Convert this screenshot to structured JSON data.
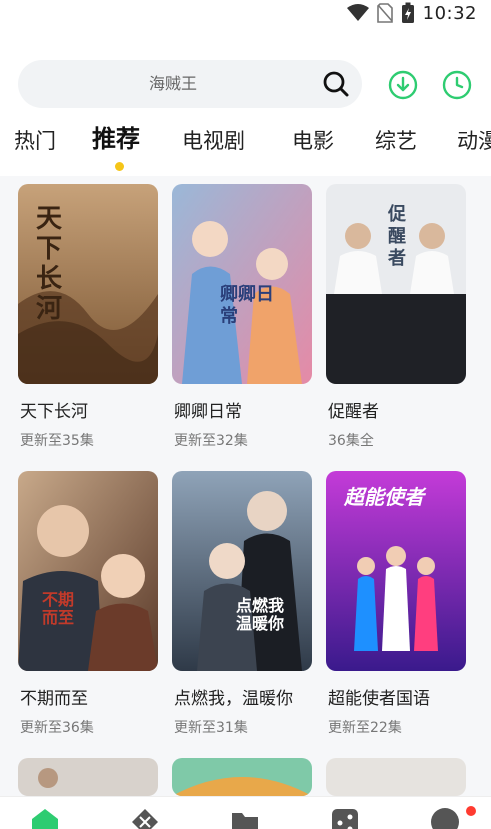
{
  "status_bar": {
    "time": "10:32"
  },
  "search": {
    "placeholder_text": "海贼王"
  },
  "tabs": [
    {
      "label": "热门"
    },
    {
      "label": "推荐",
      "active": true
    },
    {
      "label": "电视剧"
    },
    {
      "label": "电影"
    },
    {
      "label": "综艺"
    },
    {
      "label": "动漫"
    }
  ],
  "cards": [
    {
      "title": "天下长河",
      "sub": "更新至35集",
      "poster_text": "天下长河"
    },
    {
      "title": "卿卿日常",
      "sub": "更新至32集",
      "poster_text": "卿卿日常"
    },
    {
      "title": "促醒者",
      "sub": "36集全",
      "poster_text": "促醒者"
    },
    {
      "title": "不期而至",
      "sub": "更新至36集",
      "poster_text": "不期而至"
    },
    {
      "title": "点燃我，温暖你",
      "sub": "更新至31集",
      "poster_text": "点燃我温暖你"
    },
    {
      "title": "超能使者国语",
      "sub": "更新至22集",
      "poster_text": "超能使者"
    }
  ],
  "colors": {
    "accent": "#2ecc71",
    "tab_dot": "#f5c518",
    "badge": "#ff3b30"
  },
  "bottom_nav_icons": [
    "home-icon",
    "game-icon",
    "folder-icon",
    "share-icon",
    "profile-icon"
  ]
}
